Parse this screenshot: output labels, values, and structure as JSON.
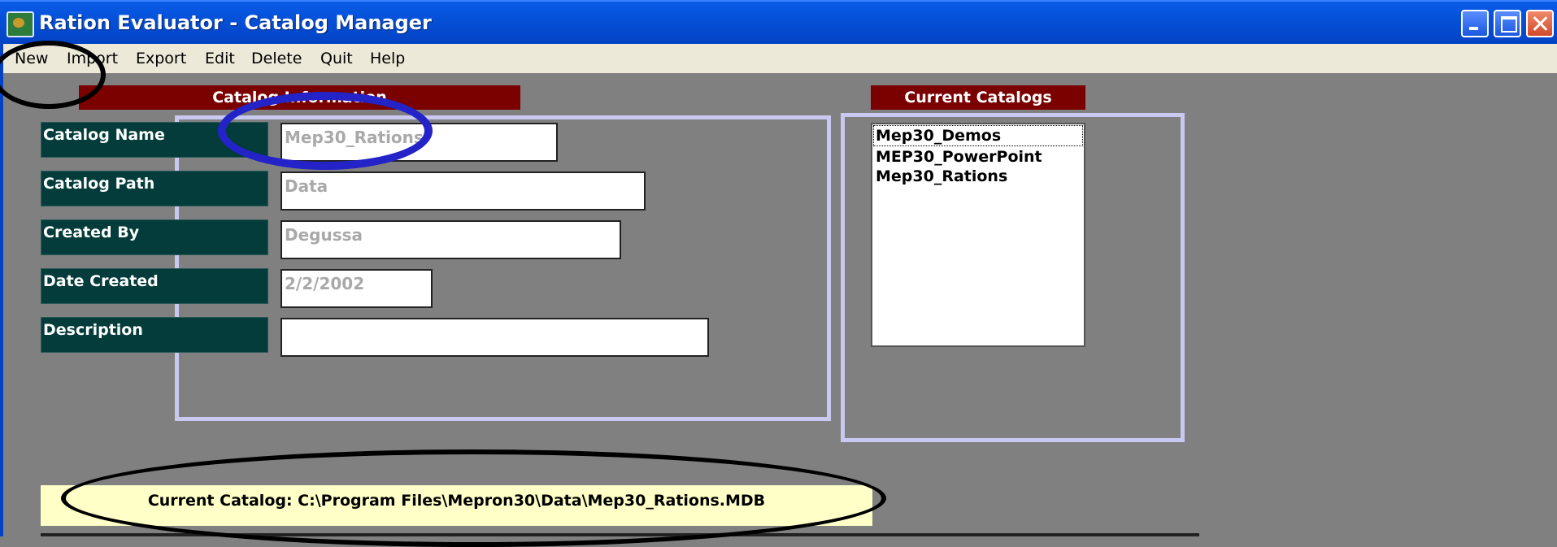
{
  "window": {
    "title": "Ration Evaluator - Catalog Manager"
  },
  "menu": {
    "items": [
      "New",
      "Import",
      "Export",
      "Edit",
      "Delete",
      "Quit",
      "Help"
    ]
  },
  "catalog_info": {
    "header": "Catalog Information",
    "fields": [
      {
        "label": "Catalog Name",
        "value": "Mep30_Rations"
      },
      {
        "label": "Catalog Path",
        "value": "Data"
      },
      {
        "label": "Created By",
        "value": "Degussa"
      },
      {
        "label": "Date Created",
        "value": "2/2/2002"
      },
      {
        "label": "Description",
        "value": ""
      }
    ]
  },
  "current_catalogs": {
    "header": "Current Catalogs",
    "items": [
      "Mep30_Demos",
      "MEP30_PowerPoint",
      "Mep30_Rations"
    ],
    "selected_index": 0
  },
  "status": {
    "text": "Current Catalog: C:\\Program Files\\Mepron30\\Data\\Mep30_Rations.MDB"
  },
  "colors": {
    "titlebar": "#0550d8",
    "background": "#808080",
    "header_red": "#7b0000",
    "label_teal": "#033c3a",
    "frame_lavender": "#c8c8f0",
    "status_yellow": "#ffffc8",
    "annotation_blue": "#2323c8",
    "annotation_black": "#000000"
  }
}
